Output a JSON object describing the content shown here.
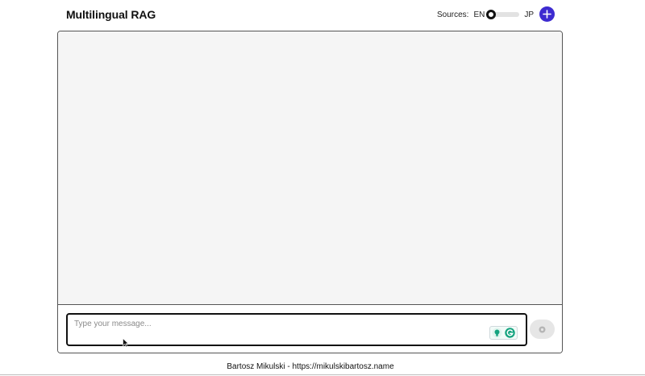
{
  "header": {
    "title": "Multilingual RAG",
    "sources_label": "Sources:",
    "lang_left": "EN",
    "lang_right": "JP",
    "toggle_selected": "EN",
    "new_chat_icon": "plus-icon"
  },
  "composer": {
    "placeholder": "Type your message...",
    "value": "",
    "assist_icons": [
      "lightbulb-icon",
      "grammarly-icon"
    ],
    "send_icon": "send-icon"
  },
  "footer": {
    "text": "Bartosz Mikulski - https://mikulskibartosz.name"
  },
  "colors": {
    "accent": "#3d2bd0",
    "messages_bg": "#f5f5f5",
    "send_disabled": "#e6e6e6"
  }
}
